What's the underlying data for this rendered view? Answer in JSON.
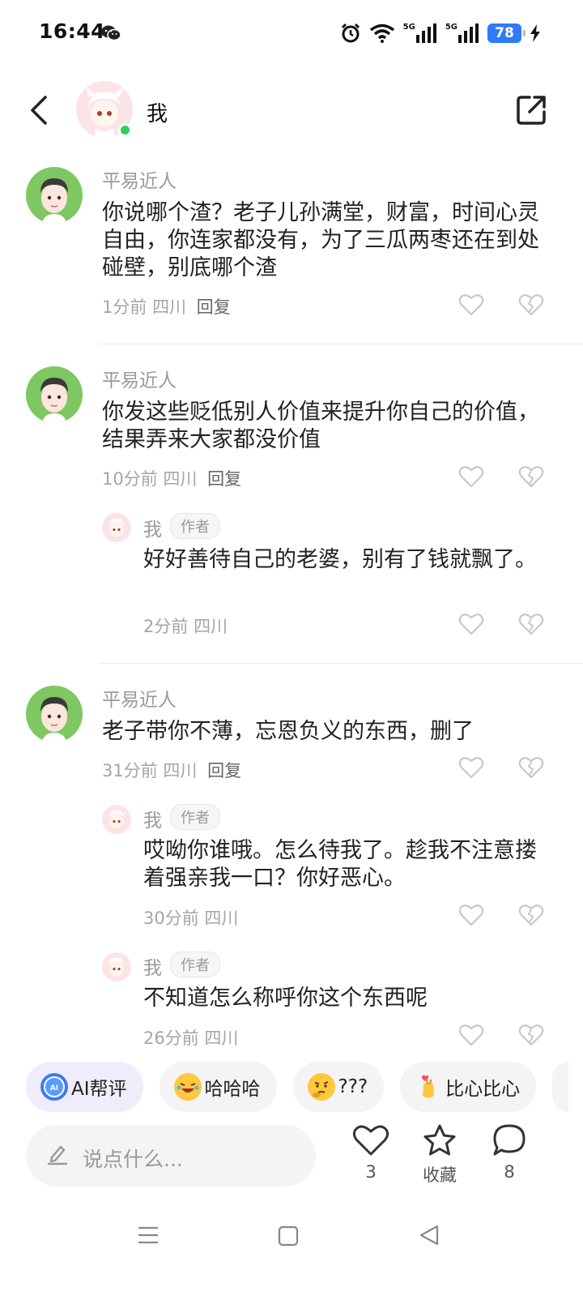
{
  "status_bar": {
    "time": "16:44",
    "network_1": "5G",
    "network_2": "5G",
    "battery": "78"
  },
  "header": {
    "name": "我"
  },
  "comments": [
    {
      "user": "平易近人",
      "text": "你说哪个渣？老子儿孙满堂，财富，时间心灵自由，你连家都没有，为了三瓜两枣还在到处碰壁，别底哪个渣",
      "time": "1分前",
      "location": "四川",
      "reply": "回复"
    },
    {
      "user": "平易近人",
      "text": "你发这些贬低别人价值来提升你自己的价值，结果弄来大家都没价值",
      "time": "10分前",
      "location": "四川",
      "reply": "回复"
    },
    {
      "user": "我",
      "tag": "作者",
      "text": "好好善待自己的老婆，别有了钱就飘了。",
      "time": "2分前",
      "location": "四川"
    },
    {
      "user": "平易近人",
      "text": "老子带你不薄，忘恩负义的东西，删了",
      "time": "31分前",
      "location": "四川",
      "reply": "回复"
    },
    {
      "user": "我",
      "tag": "作者",
      "text": "哎呦你谁哦。怎么待我了。趁我不注意搂着强亲我一口？你好恶心。",
      "time": "30分前",
      "location": "四川"
    },
    {
      "user": "我",
      "tag": "作者",
      "text": "不知道怎么称呼你这个东西呢",
      "time": "26分前",
      "location": "四川"
    }
  ],
  "quick_replies": {
    "ai": "AI帮评",
    "haha": "哈哈哈",
    "question": "???",
    "heart": "比心比心"
  },
  "bottom_bar": {
    "placeholder": "说点什么...",
    "likes": "3",
    "favorite": "收藏",
    "comments": "8"
  },
  "colors": {
    "accent_blue": "#2f7bf5",
    "online_green": "#2fcf5a",
    "avatar_green": "#7ec762",
    "avatar_pink": "#fbe3e6"
  }
}
